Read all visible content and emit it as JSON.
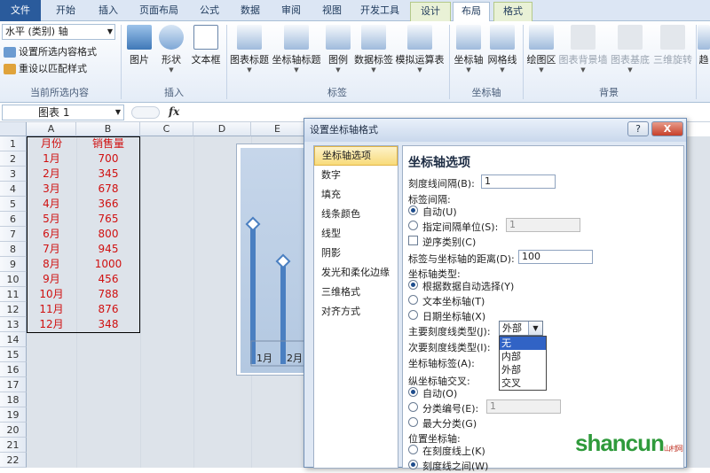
{
  "tabs": [
    {
      "label": "文件"
    },
    {
      "label": "开始"
    },
    {
      "label": "插入"
    },
    {
      "label": "页面布局"
    },
    {
      "label": "公式"
    },
    {
      "label": "数据"
    },
    {
      "label": "审阅"
    },
    {
      "label": "视图"
    },
    {
      "label": "开发工具"
    },
    {
      "label": "设计"
    },
    {
      "label": "布局"
    },
    {
      "label": "格式"
    }
  ],
  "ribbon": {
    "current_selection": {
      "value": "水平 (类别) 轴",
      "format_selection": "设置所选内容格式",
      "reset_style": "重设以匹配样式",
      "group_label": "当前所选内容"
    },
    "insert": {
      "picture": "图片",
      "shape": "形状",
      "textbox": "文本框",
      "group_label": "插入"
    },
    "labels": {
      "chart_title": "图表标题",
      "axis_title": "坐标轴标题",
      "legend": "图例",
      "data_labels": "数据标签",
      "data_table": "模拟运算表",
      "group_label": "标签"
    },
    "axes": {
      "axes": "坐标轴",
      "gridlines": "网格线",
      "group_label": "坐标轴"
    },
    "background": {
      "plot_area": "绘图区",
      "chart_wall": "图表背景墙",
      "chart_floor": "图表基底",
      "rotation": "三维旋转",
      "group_label": "背景"
    },
    "cutoff": "趋"
  },
  "formula_bar": {
    "name_box": "图表 1",
    "fx": "fx"
  },
  "columns": [
    "A",
    "B",
    "C",
    "D",
    "E"
  ],
  "rows": [
    "1",
    "2",
    "3",
    "4",
    "5",
    "6",
    "7",
    "8",
    "9",
    "10",
    "11",
    "12",
    "13",
    "14",
    "15",
    "16",
    "17",
    "18",
    "19",
    "20",
    "21",
    "22"
  ],
  "table": {
    "header": [
      "月份",
      "销售量"
    ],
    "data": [
      [
        "1月",
        "700"
      ],
      [
        "2月",
        "345"
      ],
      [
        "3月",
        "678"
      ],
      [
        "4月",
        "366"
      ],
      [
        "5月",
        "765"
      ],
      [
        "6月",
        "800"
      ],
      [
        "7月",
        "945"
      ],
      [
        "8月",
        "1000"
      ],
      [
        "9月",
        "456"
      ],
      [
        "10月",
        "788"
      ],
      [
        "11月",
        "876"
      ],
      [
        "12月",
        "348"
      ]
    ]
  },
  "chart_labels": [
    "1月",
    "2月"
  ],
  "dialog": {
    "title": "设置坐标轴格式",
    "help": "?",
    "close": "X",
    "categories": [
      "坐标轴选项",
      "数字",
      "填充",
      "线条颜色",
      "线型",
      "阴影",
      "发光和柔化边缘",
      "三维格式",
      "对齐方式"
    ],
    "panel_title": "坐标轴选项",
    "tick_interval_label": "刻度线间隔(B):",
    "tick_interval_value": "1",
    "label_interval_label": "标签间隔:",
    "auto": "自动(U)",
    "specify_interval": "指定间隔单位(S):",
    "specify_interval_value": "1",
    "reverse_order": "逆序类别(C)",
    "label_distance_label": "标签与坐标轴的距离(D):",
    "label_distance_value": "100",
    "axis_type_label": "坐标轴类型:",
    "axis_type_auto": "根据数据自动选择(Y)",
    "axis_type_text": "文本坐标轴(T)",
    "axis_type_date": "日期坐标轴(X)",
    "major_tick_label": "主要刻度线类型(J):",
    "major_tick_value": "外部",
    "minor_tick_label": "次要刻度线类型(I):",
    "axis_labels_label": "坐标轴标签(A):",
    "dropdown_options": [
      "无",
      "内部",
      "外部",
      "交叉"
    ],
    "vertical_cross_label": "纵坐标轴交叉:",
    "cross_auto": "自动(O)",
    "cross_category": "分类编号(E):",
    "cross_category_value": "1",
    "cross_max": "最大分类(G)",
    "axis_position_label": "位置坐标轴:",
    "on_tick": "在刻度线上(K)",
    "between_tick": "刻度线之间(W)"
  },
  "watermark": {
    "text": "shancun",
    "suffix": "山村网"
  },
  "colors": {
    "accent": "#2a5b9c",
    "data_text": "#d01010",
    "bar": "#4a7fc1"
  }
}
